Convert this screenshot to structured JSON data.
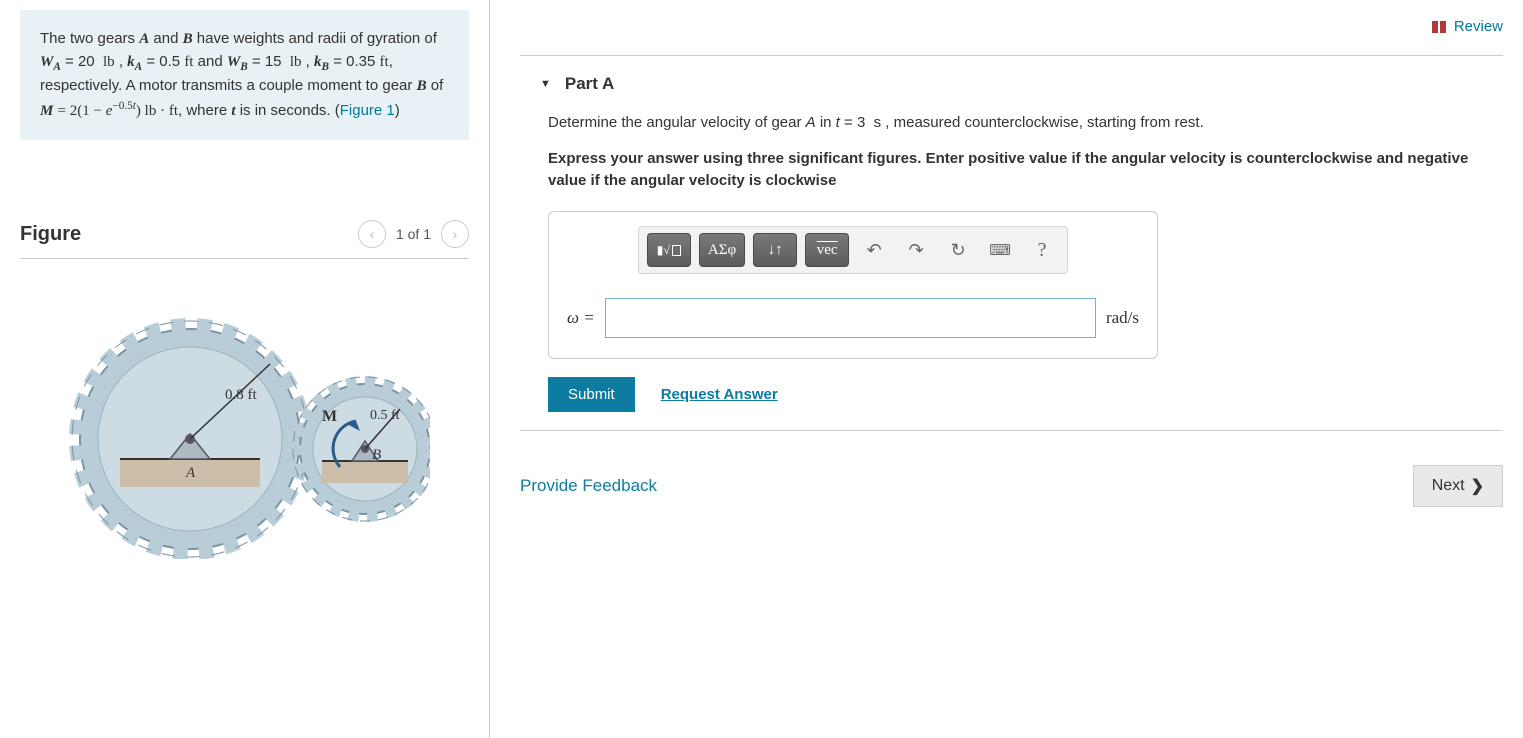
{
  "left": {
    "problem_html": "The two gears <span class='math-i'>A</span> and <span class='math-i'>B</span> have weights and radii of gyration of <span class='math-i'>W<sub>A</sub></span> = 20&nbsp; <span class='math'>lb</span> , <span class='math-i'>k<sub>A</sub></span> = 0.5 <span class='math'>ft</span> and <span class='math-i'>W<sub>B</sub></span> = 15&nbsp; <span class='math'>lb</span> , <span class='math-i'>k<sub>B</sub></span> = 0.35 <span class='math'>ft</span>, respectively. A motor transmits a couple moment to gear <span class='math-i'>B</span> of <span class='math-i'>M</span> <span class='math'>= 2(1 &minus; <i>e</i><sup>&minus;0.5<i>t</i></sup>) lb &middot; ft</span>, where <span class='math-i'>t</span> is in seconds. (<span class='fig-link' data-name='figure-link' data-interactable='true'>Figure 1</span>)",
    "figure_title": "Figure",
    "figure_counter": "1 of 1",
    "figure_labels": {
      "rA": "0.8 ft",
      "rB": "0.5 ft",
      "A": "A",
      "B": "B",
      "M": "M"
    }
  },
  "right": {
    "review": "Review",
    "part_title": "Part A",
    "question_html": "Determine the angular velocity of gear <span class='math-i' style='font-weight:normal'><i>A</i></span> in <span class='math-i' style='font-weight:normal'><i>t</i></span> = 3&nbsp; s , measured counterclockwise, starting from rest.",
    "instruction": "Express your answer using three significant figures. Enter positive value if the angular velocity is counterclockwise and negative value if the angular velocity is clockwise",
    "toolbar": {
      "templates": "■√□",
      "greek": "ΑΣφ",
      "subsup": "↓↑",
      "vec": "vec",
      "undo": "↶",
      "redo": "↷",
      "reset": "↻",
      "keyboard": "⌨",
      "help": "?"
    },
    "answer": {
      "label": "ω =",
      "value": "",
      "units": "rad/s"
    },
    "submit": "Submit",
    "request_answer": "Request Answer",
    "feedback": "Provide Feedback",
    "next": "Next"
  }
}
